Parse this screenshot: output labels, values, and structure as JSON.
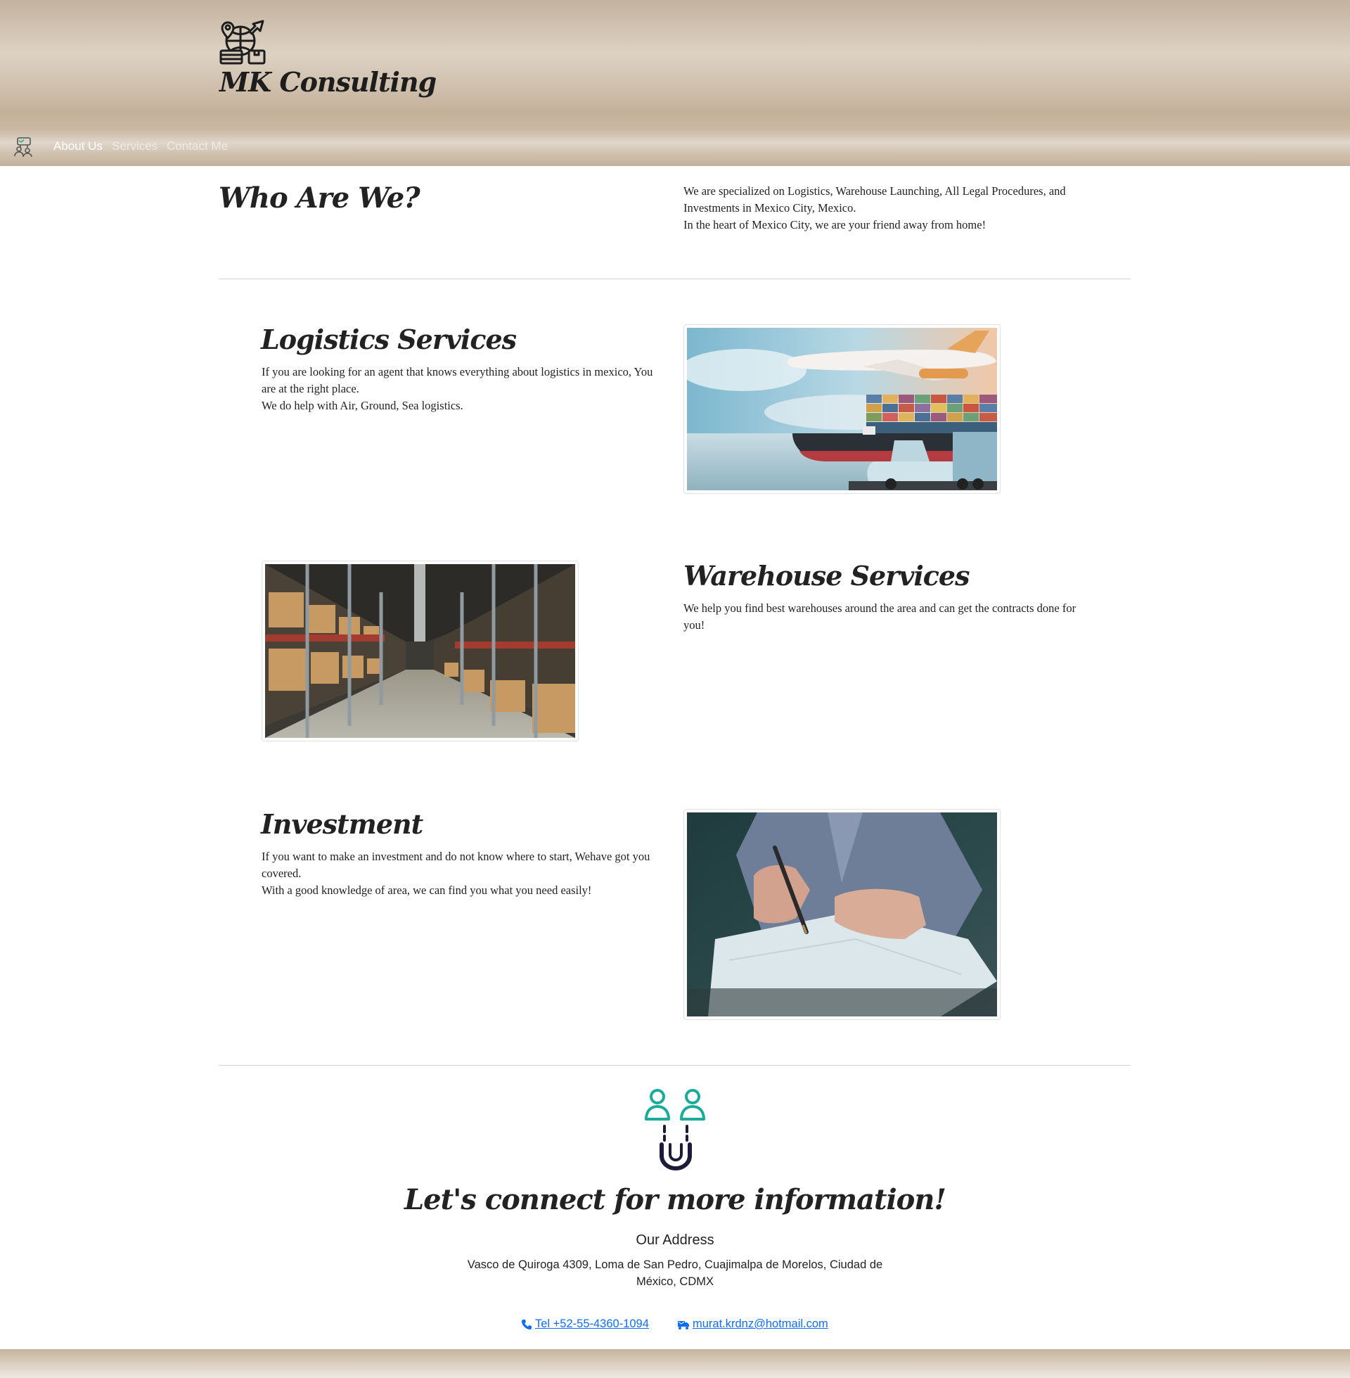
{
  "brand": {
    "name": "MK Consulting",
    "logo_icon": "logistics-globe-icon"
  },
  "nav": {
    "icon": "logistics-people-icon",
    "links": [
      {
        "label": "About Us",
        "active": true
      },
      {
        "label": "Services",
        "active": false
      },
      {
        "label": "Contact Me",
        "active": false
      }
    ]
  },
  "about": {
    "title": "Who Are We?",
    "lines": [
      "We are specialized on Logistics, Warehouse Launching, All Legal Procedures, and Investments in Mexico City, Mexico.",
      "In the heart of Mexico City, we are your friend away from home!"
    ]
  },
  "services": [
    {
      "title": "Logistics Services",
      "lines": [
        "If you are looking for an agent that knows everything about logistics in mexico, You are at the right place.",
        "We do help with Air, Ground, Sea logistics."
      ],
      "image": "airplane-ship-truck-photo"
    },
    {
      "title": "Warehouse Services",
      "lines": [
        "We help you find best warehouses around the area and can get the contracts done for you!"
      ],
      "image": "warehouse-aisle-photo"
    },
    {
      "title": "Investment",
      "lines": [
        "If you want to make an investment and do not know where to start, Wehave got you covered.",
        "With a good knowledge of area, we can find you what you need easily!"
      ],
      "image": "signing-document-photo"
    }
  ],
  "contact": {
    "icon": "people-magnet-icon",
    "title": "Let's connect for more information!",
    "address_title": "Our Address",
    "address": "Vasco de Quiroga 4309, Loma de San Pedro, Cuajimalpa de Morelos, Ciudad de México, CDMX",
    "phone_label": " Tel +52-55-4360-1094",
    "phone_icon": "phone-icon",
    "email_label": " murat.krdnz@hotmail.com",
    "email_icon": "mail-truck-icon"
  },
  "colors": {
    "header_tan": "#c9b8a3",
    "link_blue": "#0d6efd",
    "connect_teal": "#1aab9b",
    "text": "#222222"
  }
}
